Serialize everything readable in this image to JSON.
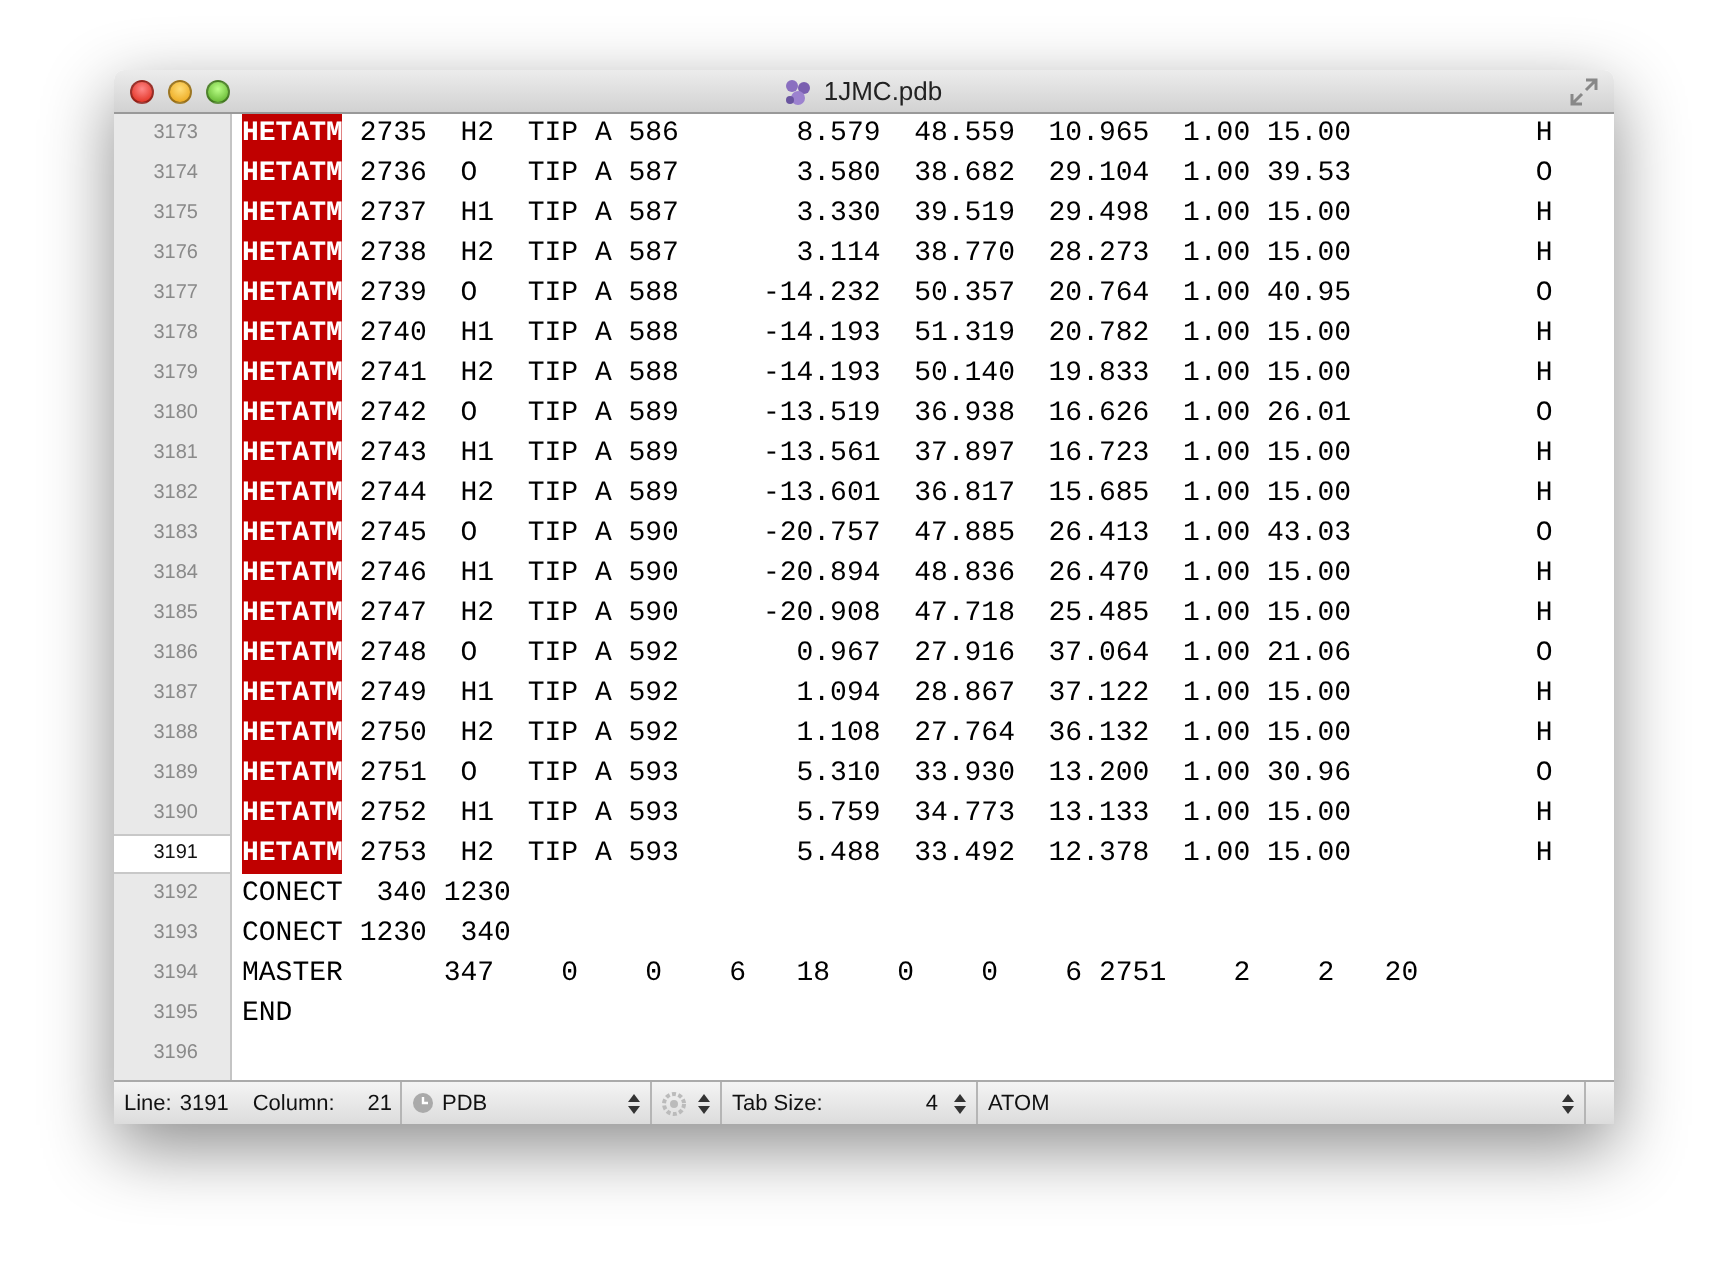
{
  "window": {
    "title": "1JMC.pdb"
  },
  "lines": [
    {
      "number": "3173",
      "kind": "hetatm",
      "record": "HETATM",
      "text": " 2735  H2  TIP A 586       8.579  48.559  10.965  1.00 15.00           H",
      "selected": false
    },
    {
      "number": "3174",
      "kind": "hetatm",
      "record": "HETATM",
      "text": " 2736  O   TIP A 587       3.580  38.682  29.104  1.00 39.53           O",
      "selected": false
    },
    {
      "number": "3175",
      "kind": "hetatm",
      "record": "HETATM",
      "text": " 2737  H1  TIP A 587       3.330  39.519  29.498  1.00 15.00           H",
      "selected": false
    },
    {
      "number": "3176",
      "kind": "hetatm",
      "record": "HETATM",
      "text": " 2738  H2  TIP A 587       3.114  38.770  28.273  1.00 15.00           H",
      "selected": false
    },
    {
      "number": "3177",
      "kind": "hetatm",
      "record": "HETATM",
      "text": " 2739  O   TIP A 588     -14.232  50.357  20.764  1.00 40.95           O",
      "selected": false
    },
    {
      "number": "3178",
      "kind": "hetatm",
      "record": "HETATM",
      "text": " 2740  H1  TIP A 588     -14.193  51.319  20.782  1.00 15.00           H",
      "selected": false
    },
    {
      "number": "3179",
      "kind": "hetatm",
      "record": "HETATM",
      "text": " 2741  H2  TIP A 588     -14.193  50.140  19.833  1.00 15.00           H",
      "selected": false
    },
    {
      "number": "3180",
      "kind": "hetatm",
      "record": "HETATM",
      "text": " 2742  O   TIP A 589     -13.519  36.938  16.626  1.00 26.01           O",
      "selected": false
    },
    {
      "number": "3181",
      "kind": "hetatm",
      "record": "HETATM",
      "text": " 2743  H1  TIP A 589     -13.561  37.897  16.723  1.00 15.00           H",
      "selected": false
    },
    {
      "number": "3182",
      "kind": "hetatm",
      "record": "HETATM",
      "text": " 2744  H2  TIP A 589     -13.601  36.817  15.685  1.00 15.00           H",
      "selected": false
    },
    {
      "number": "3183",
      "kind": "hetatm",
      "record": "HETATM",
      "text": " 2745  O   TIP A 590     -20.757  47.885  26.413  1.00 43.03           O",
      "selected": false
    },
    {
      "number": "3184",
      "kind": "hetatm",
      "record": "HETATM",
      "text": " 2746  H1  TIP A 590     -20.894  48.836  26.470  1.00 15.00           H",
      "selected": false
    },
    {
      "number": "3185",
      "kind": "hetatm",
      "record": "HETATM",
      "text": " 2747  H2  TIP A 590     -20.908  47.718  25.485  1.00 15.00           H",
      "selected": false
    },
    {
      "number": "3186",
      "kind": "hetatm",
      "record": "HETATM",
      "text": " 2748  O   TIP A 592       0.967  27.916  37.064  1.00 21.06           O",
      "selected": false
    },
    {
      "number": "3187",
      "kind": "hetatm",
      "record": "HETATM",
      "text": " 2749  H1  TIP A 592       1.094  28.867  37.122  1.00 15.00           H",
      "selected": false
    },
    {
      "number": "3188",
      "kind": "hetatm",
      "record": "HETATM",
      "text": " 2750  H2  TIP A 592       1.108  27.764  36.132  1.00 15.00           H",
      "selected": false
    },
    {
      "number": "3189",
      "kind": "hetatm",
      "record": "HETATM",
      "text": " 2751  O   TIP A 593       5.310  33.930  13.200  1.00 30.96           O",
      "selected": false
    },
    {
      "number": "3190",
      "kind": "hetatm",
      "record": "HETATM",
      "text": " 2752  H1  TIP A 593       5.759  34.773  13.133  1.00 15.00           H",
      "selected": false
    },
    {
      "number": "3191",
      "kind": "hetatm",
      "record": "HETATM",
      "text": " 2753  H2  TIP A 593       5.488  33.492  12.378  1.00 15.00           H",
      "selected": true
    },
    {
      "number": "3192",
      "kind": "plain",
      "record": "CONECT",
      "text": "  340 1230",
      "selected": false
    },
    {
      "number": "3193",
      "kind": "plain",
      "record": "CONECT",
      "text": " 1230  340",
      "selected": false
    },
    {
      "number": "3194",
      "kind": "plain",
      "record": "MASTER",
      "text": "      347    0    0    6   18    0    0    6 2751    2    2   20",
      "selected": false
    },
    {
      "number": "3195",
      "kind": "plain",
      "record": "END",
      "selected": false
    },
    {
      "number": "3196",
      "selected": false
    }
  ],
  "status_bar": {
    "line_label": "Line:",
    "line": "3191",
    "column_label": "Column:",
    "column": "21",
    "syntax": "PDB",
    "tab_size_label": "Tab Size:",
    "tab_size": "4",
    "symbol": "ATOM"
  }
}
